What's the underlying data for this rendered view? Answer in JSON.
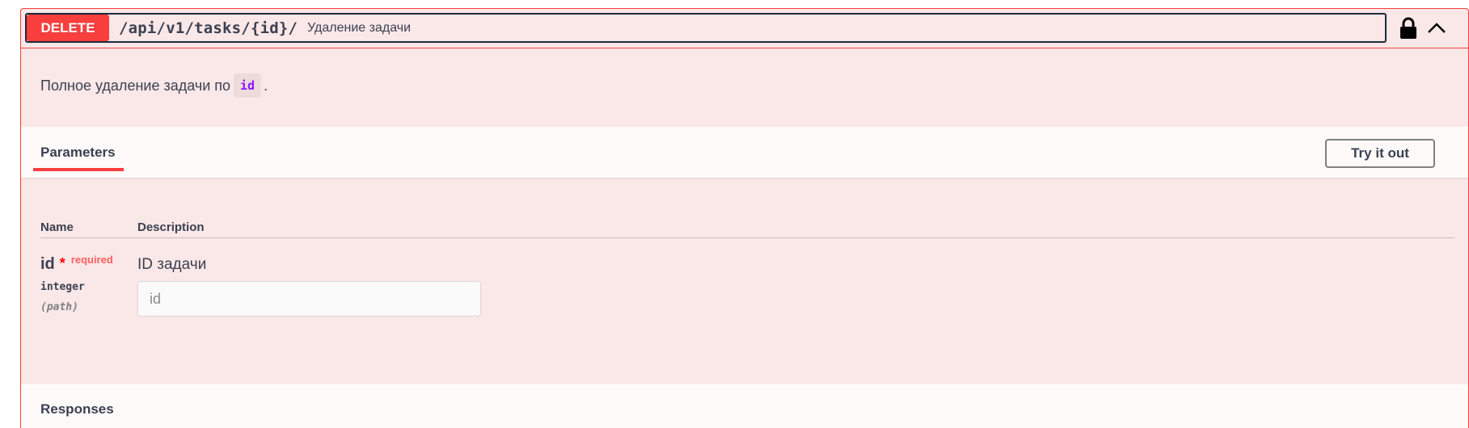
{
  "operation": {
    "method": "DELETE",
    "path": "/api/v1/tasks/{id}/",
    "summary": "Удаление задачи",
    "description_prefix": "Полное удаление задачи по",
    "description_code": "id",
    "description_suffix": "."
  },
  "parameters_section": {
    "tab_label": "Parameters",
    "try_button_label": "Try it out",
    "columns": {
      "name": "Name",
      "description": "Description"
    },
    "params": [
      {
        "name": "id",
        "required_mark": "*",
        "required_label": "required",
        "type": "integer",
        "location": "(path)",
        "description": "ID задачи",
        "input_placeholder": "id",
        "input_value": ""
      }
    ]
  },
  "responses_section": {
    "title": "Responses"
  },
  "icons": {
    "lock": "lock-icon",
    "collapse": "chevron-up-icon"
  },
  "colors": {
    "method_delete": "#f93e3e",
    "block_bg": "#fae7e7",
    "code_text": "#9012fe",
    "required": "#ff0000"
  }
}
